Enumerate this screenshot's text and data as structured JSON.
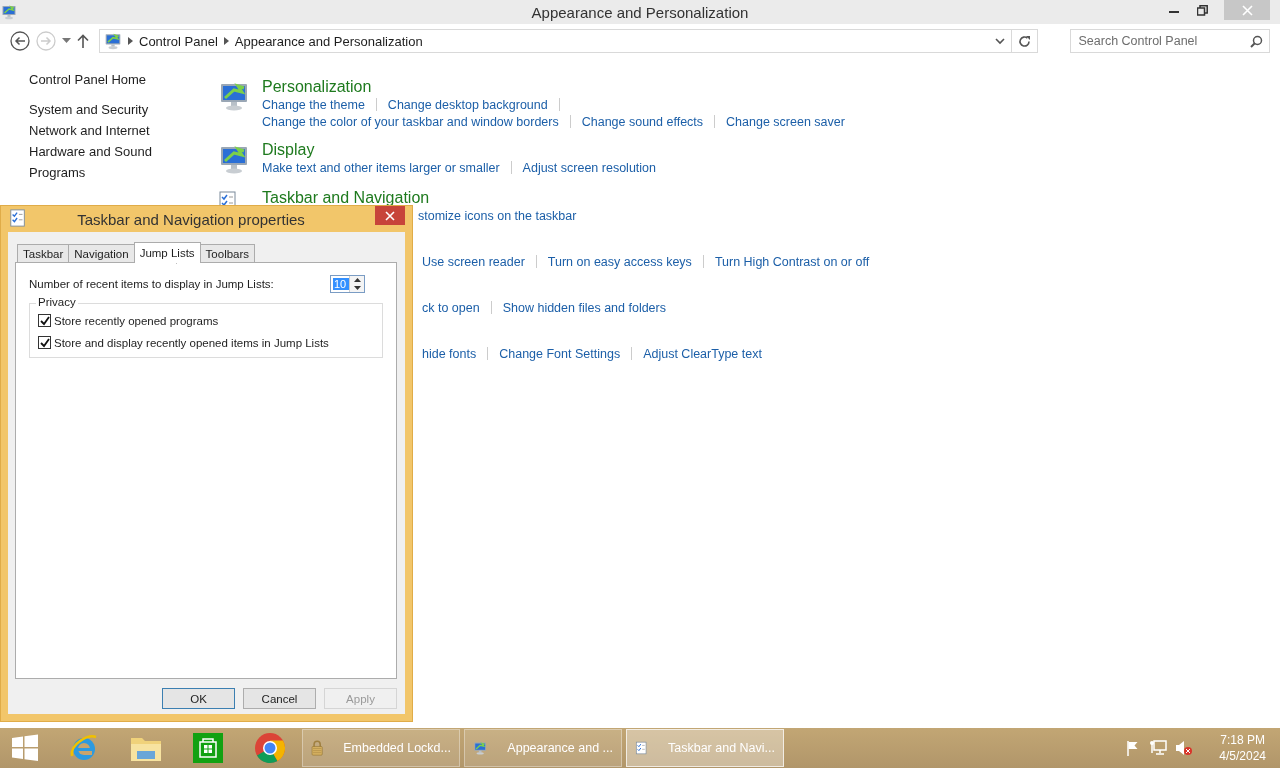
{
  "window": {
    "title": "Appearance and Personalization"
  },
  "address_bar": {
    "breadcrumbs": [
      "Control Panel",
      "Appearance and Personalization"
    ]
  },
  "search": {
    "placeholder": "Search Control Panel"
  },
  "sidebar": {
    "items": [
      {
        "label": "Control Panel Home",
        "kind": "home"
      },
      {
        "label": "System and Security",
        "kind": "category"
      },
      {
        "label": "Network and Internet",
        "kind": "category"
      },
      {
        "label": "Hardware and Sound",
        "kind": "category"
      },
      {
        "label": "Programs",
        "kind": "category"
      }
    ]
  },
  "categories": [
    {
      "kind": "full",
      "title": "Personalization",
      "link_lines": [
        [
          "Change the theme",
          "Change desktop background"
        ],
        [
          "Change the color of your taskbar and window borders",
          "Change sound effects",
          "Change screen saver"
        ]
      ]
    },
    {
      "kind": "full",
      "title": "Display",
      "link_lines": [
        [
          "Make text and other items larger or smaller",
          "Adjust screen resolution"
        ]
      ]
    },
    {
      "kind": "partial",
      "title": "Taskbar and Navigation",
      "link_lines": [
        [
          "stomize icons on the taskbar"
        ]
      ]
    },
    {
      "kind": "covered",
      "link_lines": [
        [
          "Use screen reader",
          "Turn on easy access keys",
          "Turn High Contrast on or off"
        ]
      ]
    },
    {
      "kind": "covered",
      "link_lines": [
        [
          "ck to open",
          "Show hidden files and folders"
        ]
      ]
    },
    {
      "kind": "covered",
      "link_lines": [
        [
          "hide fonts",
          "Change Font Settings",
          "Adjust ClearType text"
        ]
      ]
    }
  ],
  "dialog": {
    "title": "Taskbar and Navigation properties",
    "tabs": [
      {
        "label": "Taskbar",
        "selected": false
      },
      {
        "label": "Navigation",
        "selected": false
      },
      {
        "label": "Jump Lists",
        "selected": true
      },
      {
        "label": "Toolbars",
        "selected": false
      }
    ],
    "recent_items": {
      "label": "Number of recent items to display in Jump Lists:",
      "value": "10"
    },
    "privacy": {
      "title": "Privacy",
      "options": [
        {
          "label": "Store recently opened programs",
          "checked": true
        },
        {
          "label": "Store and display recently opened items in Jump Lists",
          "checked": true
        }
      ]
    },
    "buttons": [
      {
        "label": "OK",
        "default": true,
        "disabled": false
      },
      {
        "label": "Cancel",
        "default": false,
        "disabled": false
      },
      {
        "label": "Apply",
        "default": false,
        "disabled": true
      }
    ]
  },
  "taskbar": {
    "pinned": [
      {
        "kind": "ie"
      },
      {
        "kind": "explorer"
      },
      {
        "kind": "store"
      },
      {
        "kind": "chrome"
      }
    ],
    "tasks": [
      {
        "kind": "lock",
        "label": "Embedded Lockd...",
        "selected": false
      },
      {
        "kind": "monitor",
        "label": "Appearance and ...",
        "selected": false
      },
      {
        "kind": "checklist",
        "label": "Taskbar and Navi...",
        "selected": true
      }
    ],
    "tray": [
      {
        "kind": "flag"
      },
      {
        "kind": "network"
      },
      {
        "kind": "muted"
      }
    ],
    "time": "7:18 PM",
    "date": "4/5/2024"
  }
}
